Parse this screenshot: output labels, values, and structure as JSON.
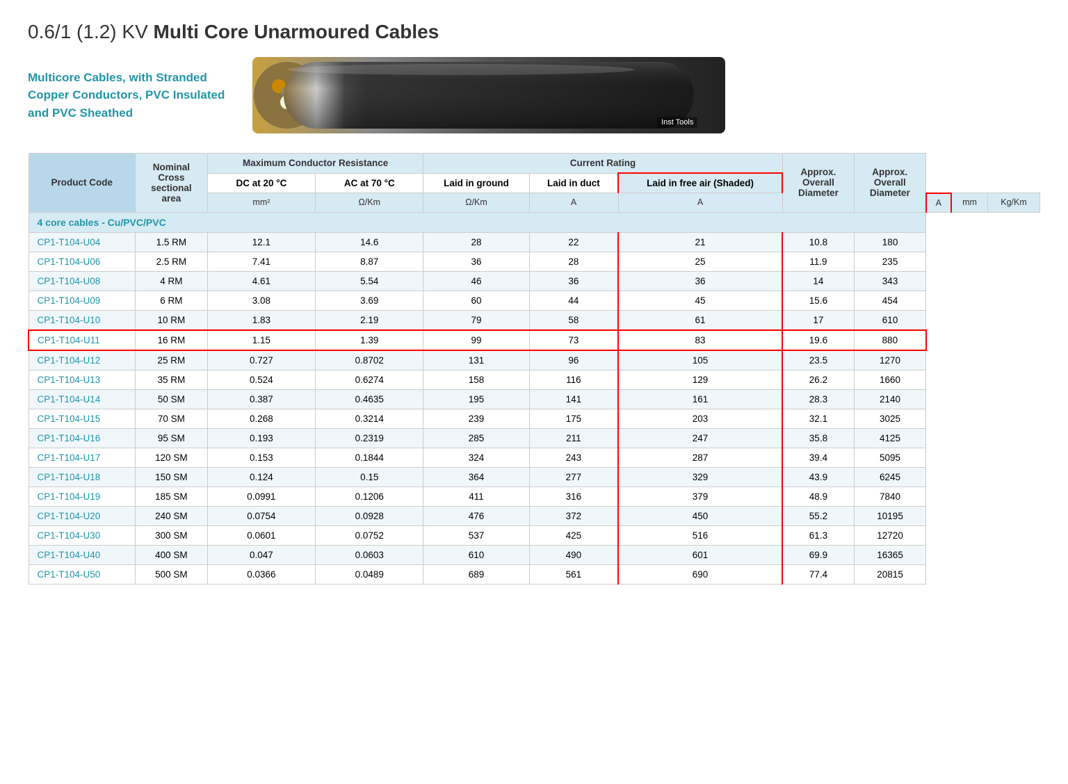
{
  "title": {
    "prefix": "0.6/1 (1.2) KV ",
    "bold": "Multi Core Unarmoured Cables"
  },
  "intro": {
    "text": "Multicore Cables, with Stranded\nCopper Conductors, PVC Insulated\nand PVC Sheathed",
    "image_label": "Inst Tools"
  },
  "table": {
    "headers": {
      "product_code": "Product Code",
      "nominal_cross": "Nominal Cross sectional area",
      "max_conductor_resistance": "Maximum Conductor Resistance",
      "current_rating": "Current Rating",
      "approx_overall_diameter": "Approx. Overall Diameter",
      "approx_overall_weight": "Approx. Overall Diameter"
    },
    "sub_headers": {
      "dc_20": "DC at 20 °C",
      "ac_70": "AC at 70 °C",
      "laid_ground": "Laid in ground",
      "laid_duct": "Laid in duct",
      "laid_free_air": "Laid in free air (Shaded)"
    },
    "units": {
      "mm2": "mm²",
      "ohm_km_dc": "Ω/Km",
      "ohm_km_ac": "Ω/Km",
      "amp_a": "A",
      "amp_b": "A",
      "amp_c": "A",
      "mm": "mm",
      "kg_km": "Kg/Km"
    },
    "section_label": "4 core cables - Cu/PVC/PVC",
    "rows": [
      {
        "code": "CP1-T104-U04",
        "area": "1.5 RM",
        "dc20": "12.1",
        "ac70": "14.6",
        "ground": "28",
        "duct": "22",
        "free_air": "21",
        "diameter": "10.8",
        "weight": "180",
        "highlighted": false
      },
      {
        "code": "CP1-T104-U06",
        "area": "2.5 RM",
        "dc20": "7.41",
        "ac70": "8.87",
        "ground": "36",
        "duct": "28",
        "free_air": "25",
        "diameter": "11.9",
        "weight": "235",
        "highlighted": false
      },
      {
        "code": "CP1-T104-U08",
        "area": "4 RM",
        "dc20": "4.61",
        "ac70": "5.54",
        "ground": "46",
        "duct": "36",
        "free_air": "36",
        "diameter": "14",
        "weight": "343",
        "highlighted": false
      },
      {
        "code": "CP1-T104-U09",
        "area": "6 RM",
        "dc20": "3.08",
        "ac70": "3.69",
        "ground": "60",
        "duct": "44",
        "free_air": "45",
        "diameter": "15.6",
        "weight": "454",
        "highlighted": false
      },
      {
        "code": "CP1-T104-U10",
        "area": "10 RM",
        "dc20": "1.83",
        "ac70": "2.19",
        "ground": "79",
        "duct": "58",
        "free_air": "61",
        "diameter": "17",
        "weight": "610",
        "highlighted": false
      },
      {
        "code": "CP1-T104-U11",
        "area": "16 RM",
        "dc20": "1.15",
        "ac70": "1.39",
        "ground": "99",
        "duct": "73",
        "free_air": "83",
        "diameter": "19.6",
        "weight": "880",
        "highlighted": true
      },
      {
        "code": "CP1-T104-U12",
        "area": "25 RM",
        "dc20": "0.727",
        "ac70": "0.8702",
        "ground": "131",
        "duct": "96",
        "free_air": "105",
        "diameter": "23.5",
        "weight": "1270",
        "highlighted": false
      },
      {
        "code": "CP1-T104-U13",
        "area": "35 RM",
        "dc20": "0.524",
        "ac70": "0.6274",
        "ground": "158",
        "duct": "116",
        "free_air": "129",
        "diameter": "26.2",
        "weight": "1660",
        "highlighted": false
      },
      {
        "code": "CP1-T104-U14",
        "area": "50 SM",
        "dc20": "0.387",
        "ac70": "0.4635",
        "ground": "195",
        "duct": "141",
        "free_air": "161",
        "diameter": "28.3",
        "weight": "2140",
        "highlighted": false
      },
      {
        "code": "CP1-T104-U15",
        "area": "70 SM",
        "dc20": "0.268",
        "ac70": "0.3214",
        "ground": "239",
        "duct": "175",
        "free_air": "203",
        "diameter": "32.1",
        "weight": "3025",
        "highlighted": false
      },
      {
        "code": "CP1-T104-U16",
        "area": "95 SM",
        "dc20": "0.193",
        "ac70": "0.2319",
        "ground": "285",
        "duct": "211",
        "free_air": "247",
        "diameter": "35.8",
        "weight": "4125",
        "highlighted": false
      },
      {
        "code": "CP1-T104-U17",
        "area": "120 SM",
        "dc20": "0.153",
        "ac70": "0.1844",
        "ground": "324",
        "duct": "243",
        "free_air": "287",
        "diameter": "39.4",
        "weight": "5095",
        "highlighted": false
      },
      {
        "code": "CP1-T104-U18",
        "area": "150 SM",
        "dc20": "0.124",
        "ac70": "0.15",
        "ground": "364",
        "duct": "277",
        "free_air": "329",
        "diameter": "43.9",
        "weight": "6245",
        "highlighted": false
      },
      {
        "code": "CP1-T104-U19",
        "area": "185 SM",
        "dc20": "0.0991",
        "ac70": "0.1206",
        "ground": "411",
        "duct": "316",
        "free_air": "379",
        "diameter": "48.9",
        "weight": "7840",
        "highlighted": false
      },
      {
        "code": "CP1-T104-U20",
        "area": "240 SM",
        "dc20": "0.0754",
        "ac70": "0.0928",
        "ground": "476",
        "duct": "372",
        "free_air": "450",
        "diameter": "55.2",
        "weight": "10195",
        "highlighted": false
      },
      {
        "code": "CP1-T104-U30",
        "area": "300 SM",
        "dc20": "0.0601",
        "ac70": "0.0752",
        "ground": "537",
        "duct": "425",
        "free_air": "516",
        "diameter": "61.3",
        "weight": "12720",
        "highlighted": false
      },
      {
        "code": "CP1-T104-U40",
        "area": "400 SM",
        "dc20": "0.047",
        "ac70": "0.0603",
        "ground": "610",
        "duct": "490",
        "free_air": "601",
        "diameter": "69.9",
        "weight": "16365",
        "highlighted": false
      },
      {
        "code": "CP1-T104-U50",
        "area": "500 SM",
        "dc20": "0.0366",
        "ac70": "0.0489",
        "ground": "689",
        "duct": "561",
        "free_air": "690",
        "diameter": "77.4",
        "weight": "20815",
        "highlighted": false
      }
    ]
  }
}
